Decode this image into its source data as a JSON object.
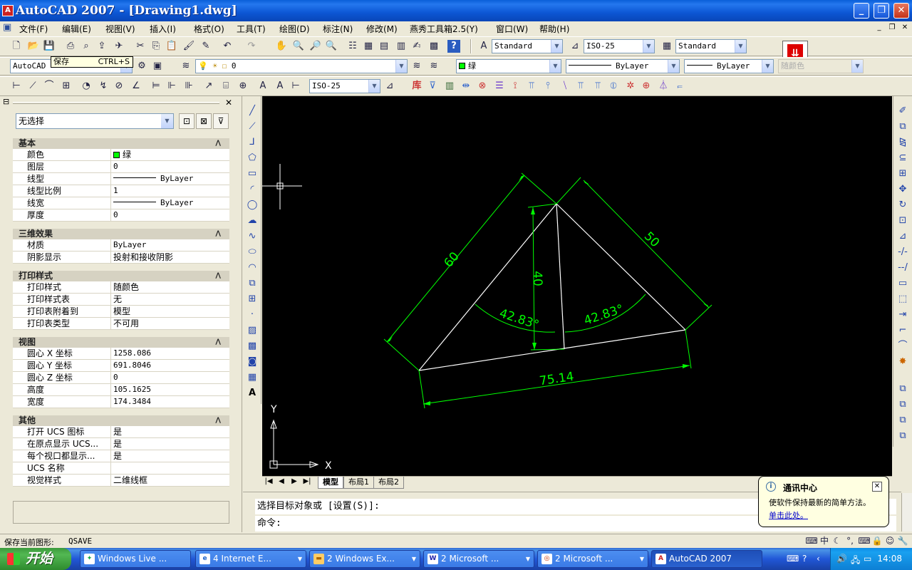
{
  "window": {
    "title": "AutoCAD 2007 - [Drawing1.dwg]",
    "min": "_",
    "max": "❐",
    "close": "✕"
  },
  "menu": {
    "items": [
      "文件(F)",
      "编辑(E)",
      "视图(V)",
      "插入(I)",
      "格式(O)",
      "工具(T)",
      "绘图(D)",
      "标注(N)",
      "修改(M)",
      "燕秀工具箱2.5(Y)",
      "窗口(W)",
      "帮助(H)"
    ],
    "doc_min": "_",
    "doc_restore": "❐",
    "doc_close": "✕"
  },
  "tooltip": {
    "label": "保存",
    "shortcut": "CTRL+S"
  },
  "toolbar1": {
    "text_style": "Standard",
    "dim_style": "ISO-25",
    "table_style": "Standard"
  },
  "toolbar2": {
    "workspace": "AutoCAD",
    "layer": "0",
    "color": "绿",
    "linetype": "ByLayer",
    "lineweight": "ByLayer",
    "plotstyle": "随颜色"
  },
  "toolbar3": {
    "dim_style": "ISO-25"
  },
  "properties": {
    "selection": "无选择",
    "sections": [
      {
        "title": "基本",
        "rows": [
          {
            "key": "颜色",
            "value": "绿",
            "kind": "color"
          },
          {
            "key": "图层",
            "value": "0"
          },
          {
            "key": "线型",
            "value": "ByLayer",
            "kind": "line"
          },
          {
            "key": "线型比例",
            "value": "1"
          },
          {
            "key": "线宽",
            "value": "ByLayer",
            "kind": "line"
          },
          {
            "key": "厚度",
            "value": "0"
          }
        ]
      },
      {
        "title": "三维效果",
        "rows": [
          {
            "key": "材质",
            "value": "ByLayer"
          },
          {
            "key": "阴影显示",
            "value": "投射和接收阴影",
            "kind": "cjk"
          }
        ]
      },
      {
        "title": "打印样式",
        "rows": [
          {
            "key": "打印样式",
            "value": "随颜色",
            "kind": "cjk"
          },
          {
            "key": "打印样式表",
            "value": "无",
            "kind": "cjk"
          },
          {
            "key": "打印表附着到",
            "value": "模型",
            "kind": "cjk"
          },
          {
            "key": "打印表类型",
            "value": "不可用",
            "kind": "cjk"
          }
        ]
      },
      {
        "title": "视图",
        "rows": [
          {
            "key": "圆心 X 坐标",
            "value": "1258.086"
          },
          {
            "key": "圆心 Y 坐标",
            "value": "691.8046"
          },
          {
            "key": "圆心 Z 坐标",
            "value": "0"
          },
          {
            "key": "高度",
            "value": "105.1625"
          },
          {
            "key": "宽度",
            "value": "174.3484"
          }
        ]
      },
      {
        "title": "其他",
        "rows": [
          {
            "key": "打开 UCS 图标",
            "value": "是",
            "kind": "cjk"
          },
          {
            "key": "在原点显示 UCS...",
            "value": "是",
            "kind": "cjk"
          },
          {
            "key": "每个视口都显示...",
            "value": "是",
            "kind": "cjk"
          },
          {
            "key": "UCS 名称",
            "value": ""
          },
          {
            "key": "视觉样式",
            "value": "二维线框",
            "kind": "cjk"
          }
        ]
      }
    ]
  },
  "drawing": {
    "dim_left": "60",
    "dim_right": "50",
    "dim_height": "40",
    "dim_base": "75.14",
    "angle_left": "42.83°",
    "angle_right": "42.83°",
    "ucs_x": "X",
    "ucs_y": "Y",
    "colors": {
      "dim": "#00ff00",
      "geom": "#ffffff",
      "bg": "#000000"
    }
  },
  "layout_tabs": [
    "模型",
    "布局1",
    "布局2"
  ],
  "command": {
    "line1": "选择目标对象或 [设置(S)]:",
    "line2": "命令:"
  },
  "balloon": {
    "title": "通讯中心",
    "message": "使软件保持最新的简单方法。",
    "link": "单击此处。"
  },
  "status": {
    "label": "保存当前图形:",
    "command": "QSAVE"
  },
  "taskbar": {
    "start": "开始",
    "tasks": [
      {
        "label": "Windows Live ...",
        "icon": "messenger-icon"
      },
      {
        "label": "4 Internet E...",
        "icon": "ie-icon"
      },
      {
        "label": "2 Windows Ex...",
        "icon": "folder-icon"
      },
      {
        "label": "2 Microsoft ...",
        "icon": "word-icon"
      },
      {
        "label": "2 Microsoft ...",
        "icon": "office-icon"
      },
      {
        "label": "AutoCAD 2007",
        "icon": "autocad-icon"
      }
    ],
    "clock": "14:08",
    "ime": "中"
  }
}
